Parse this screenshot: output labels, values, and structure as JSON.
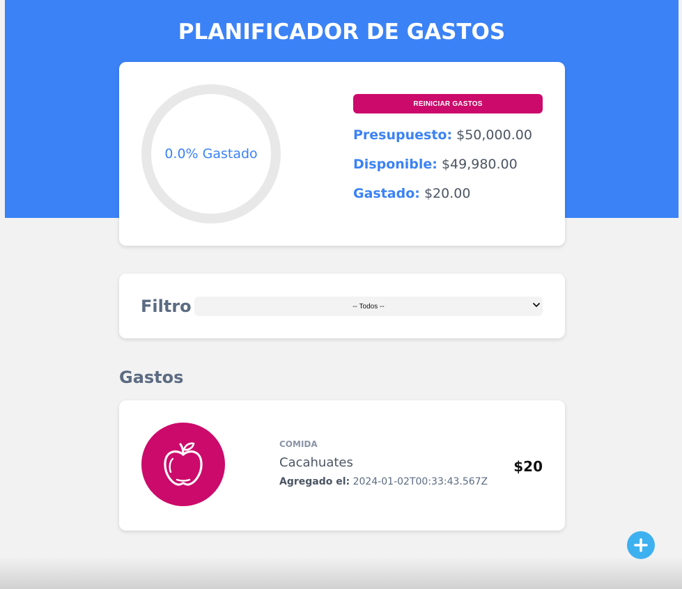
{
  "header": {
    "title": "PLANIFICADOR DE GASTOS"
  },
  "budget": {
    "progress_percent": 0.0,
    "progress_text": "0.0% Gastado",
    "reset_label": "REINICIAR GASTOS",
    "budget_label": "Presupuesto:",
    "budget_value": "$50,000.00",
    "available_label": "Disponible:",
    "available_value": "$49,980.00",
    "spent_label": "Gastado:",
    "spent_value": "$20.00"
  },
  "filter": {
    "label": "Filtro",
    "selected": "-- Todos --"
  },
  "expenses": {
    "title": "Gastos",
    "items": [
      {
        "category": "COMIDA",
        "name": "Cacahuates",
        "date_label": "Agregado el:",
        "date_value": "2024-01-02T00:33:43.567Z",
        "amount": "$20",
        "icon": "apple-icon"
      }
    ]
  },
  "add_button": {
    "icon": "plus-icon"
  },
  "colors": {
    "header": "#3b82f6",
    "accent": "#cc0a6b",
    "label_blue": "#3b82f6",
    "add_button": "#3db0f0"
  }
}
